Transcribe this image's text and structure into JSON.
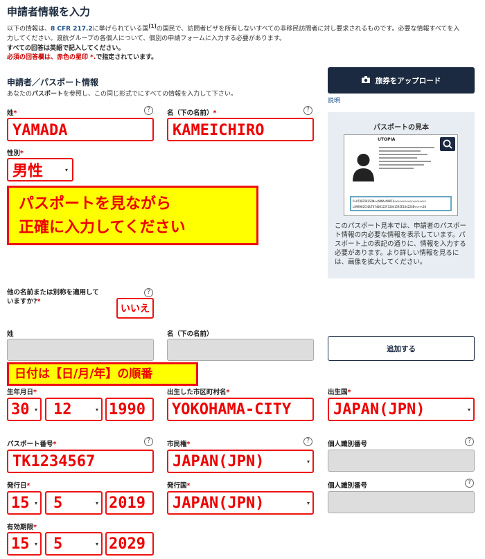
{
  "header": {
    "title": "申請者情報を入力",
    "intro1_pre": "以下の情報は、",
    "intro1_cfr": "8 CFR 217.2",
    "intro1_mid": "に挙げられている国",
    "intro1_ref": "[1]",
    "intro1_post": "の国民で、訪問者ビザを所有しないすべての非移民訪問者に対し要求されるものです。必要な情報すべてを入",
    "intro2": "力してください。渡航グループの各個人について、個別の申請フォームに入力する必要があります。",
    "note_english": "すべての回答は英語で記入してください。",
    "note_required": "必須の回答欄は、赤色の星印",
    "note_required_end": "で指定されています。",
    "asterisk": "*"
  },
  "section": {
    "title": "申請者／パスポート情報",
    "desc_pre": "あなたの",
    "desc_bold": "パスポート",
    "desc_post": "を参照し、この同じ形式でにすべての情報を入力して下さい。"
  },
  "upload": {
    "button_label": "旅券をアップロード",
    "icon": "camera-icon",
    "explain_link": "説明"
  },
  "passport_sample": {
    "title": "パスポートの見本",
    "country": "UTOPIA",
    "mrz1": "P<UTOERIKSSON<<ANNA<MARIA<<<<<<<<<<<<<<<<<<<",
    "mrz2": "L898902C36UTO7408122F1204159ZE184226B<<<<<10",
    "description": "このパスポート見本では、申請者のパスポート情報の内必要な情報を表示しています。パスポート上の表記の通りに、情報を入力する必要があります。より詳しい情報を見るには、画像を拡大してください。"
  },
  "fields": {
    "surname_label": "姓",
    "surname_value": "YAMADA",
    "given_label": "名（下の名前）",
    "given_value": "KAMEICHIRO",
    "sex_label": "性別",
    "sex_value": "男性",
    "alias_label_1": "他の名前または別称を適用して",
    "alias_label_2": "いますか?",
    "alias_value": "いいえ",
    "alias_surname_label": "姓",
    "alias_given_label": "名（下の名前）",
    "add_button": "追加する",
    "dob_label": "生年月日",
    "dob_day": "30",
    "dob_month": "12",
    "dob_year": "1990",
    "birth_city_label": "出生した市区町村名",
    "birth_city_value": "YOKOHAMA-CITY",
    "birth_country_label": "出生国",
    "birth_country_value": "JAPAN(JPN)",
    "passport_no_label": "パスポート番号",
    "passport_no_value": "TK1234567",
    "citizenship_label": "市民権",
    "citizenship_value": "JAPAN(JPN)",
    "personal_id_label": "個人識別番号",
    "issue_date_label": "発行日",
    "issue_day": "15",
    "issue_month": "5",
    "issue_year": "2019",
    "issue_country_label": "発行国",
    "issue_country_value": "JAPAN(JPN)",
    "personal_id2_label": "個人識別番号",
    "expiry_label": "有効期限",
    "expiry_day": "15",
    "expiry_month": "5",
    "expiry_year": "2029"
  },
  "callouts": {
    "passport_line1": "パスポートを見ながら",
    "passport_line2": "正確に入力してください",
    "date_order": "日付は【日/月/年】の順番"
  },
  "colors": {
    "navy": "#1b2a40",
    "annotation_red": "#e00",
    "annotation_yellow": "#ffff00"
  }
}
